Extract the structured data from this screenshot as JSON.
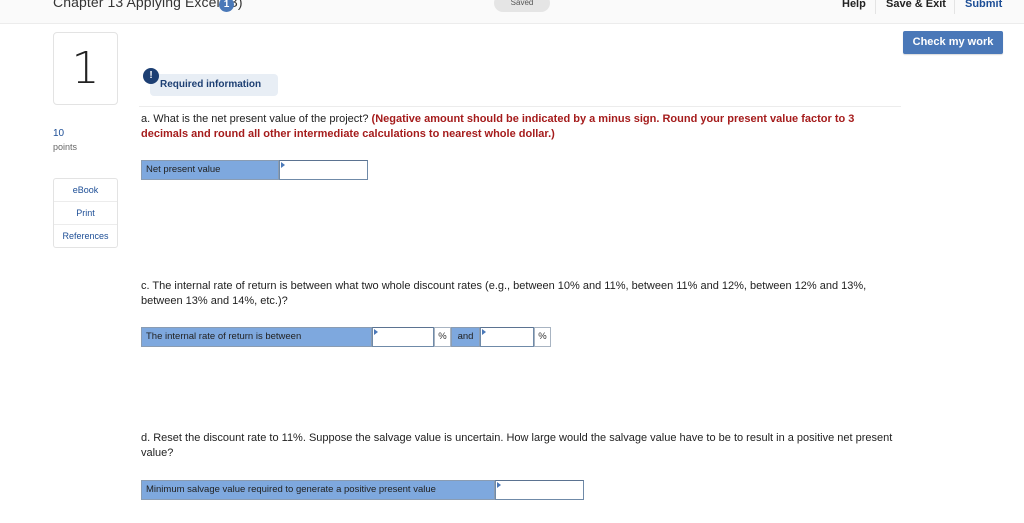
{
  "header": {
    "chapter_title": "Chapter 13 Applying Excel (B)",
    "chapter_badge": "1",
    "saved_status": "Saved",
    "nav": {
      "help": "Help",
      "save_exit": "Save & Exit",
      "submit": "Submit"
    },
    "check_my_work": "Check my work"
  },
  "question": {
    "number": "1",
    "points_value": "10",
    "points_label": "points"
  },
  "sidebar": {
    "links": [
      "eBook",
      "Print",
      "References"
    ]
  },
  "required_info": {
    "icon": "!",
    "label": "Required information"
  },
  "parts": {
    "a": {
      "prompt": "a. What is the net present value of the project? ",
      "instruction": "(Negative amount should be indicated by a minus sign. Round your present value factor to 3 decimals and round all other intermediate calculations to nearest whole dollar.)",
      "row_label": "Net present value",
      "value": ""
    },
    "c": {
      "prompt": "c. The internal rate of return is between what two whole discount rates (e.g., between 10% and 11%, between 11% and 12%, between 12% and 13%, between 13% and 14%, etc.)?",
      "row_label": "The internal rate of return is between",
      "value_low": "",
      "unit_low": "%",
      "and_label": "and",
      "value_high": "",
      "unit_high": "%"
    },
    "d": {
      "prompt": "d. Reset the discount rate to 11%. Suppose the salvage value is uncertain. How large would the salvage value have to be to result in a positive net present value?",
      "row_label": "Minimum salvage value required to generate a positive present value",
      "value": ""
    }
  },
  "colors": {
    "accent_blue": "#4a78b8",
    "link_blue": "#1d4e96",
    "instruction_red": "#a51c1c",
    "label_cell_blue": "#7ea8de"
  }
}
